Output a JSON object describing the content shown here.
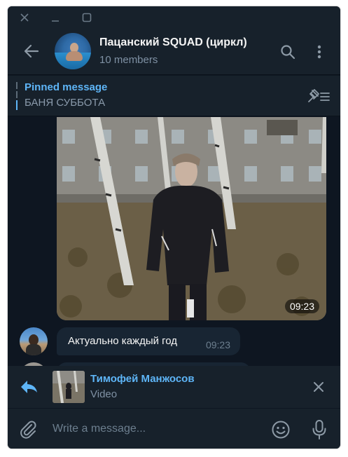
{
  "window": {
    "controls": [
      "close-icon",
      "minimize-icon",
      "maximize-icon"
    ]
  },
  "header": {
    "title": "Пацанский SQUAD (циркл)",
    "subtitle": "10 members",
    "icons": [
      "back-arrow-icon",
      "search-icon",
      "more-vertical-icon"
    ]
  },
  "pinned": {
    "title": "Pinned message",
    "text": "БАНЯ СУББОТА",
    "icon": "unpin-list-icon"
  },
  "messages": [
    {
      "type": "video",
      "time": "09:23"
    },
    {
      "type": "text",
      "text": "Актуально каждый год",
      "time": "09:23"
    }
  ],
  "reply": {
    "icon": "reply-arrow-icon",
    "name": "Тимофей Манжосов",
    "type": "Video",
    "close_icon": "close-icon"
  },
  "composer": {
    "placeholder": "Write a message...",
    "icons": [
      "paperclip-icon",
      "emoji-icon",
      "microphone-icon"
    ]
  },
  "colors": {
    "background": "#0e1621",
    "panel": "#17212b",
    "bubble": "#182533",
    "accent": "#5eb5f7",
    "muted": "#7f91a4"
  }
}
